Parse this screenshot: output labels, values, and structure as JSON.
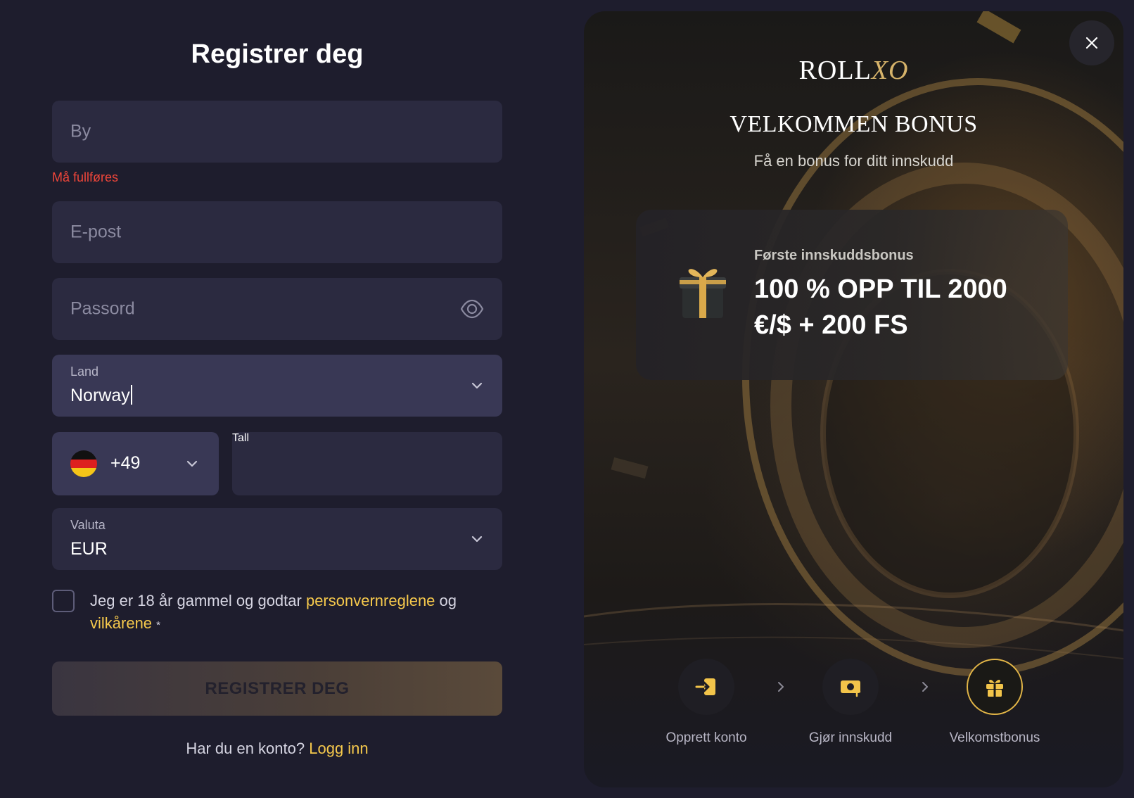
{
  "form": {
    "title": "Registrer deg",
    "city": {
      "placeholder": "By",
      "error": "Må fullføres"
    },
    "email": {
      "placeholder": "E-post"
    },
    "password": {
      "placeholder": "Passord"
    },
    "country": {
      "label": "Land",
      "value": "Norway"
    },
    "phone": {
      "code": "+49",
      "placeholder": "Tall"
    },
    "currency": {
      "label": "Valuta",
      "value": "EUR"
    },
    "consent": {
      "text_before": "Jeg er 18 år gammel og godtar ",
      "privacy_link": "personvernreglene",
      "text_middle": " og ",
      "terms_link": "vilkårene",
      "required_mark": "*"
    },
    "submit_label": "REGISTRER DEG",
    "login_prompt": "Har du en konto? ",
    "login_link": "Logg inn"
  },
  "promo": {
    "logo_main": "ROLL",
    "logo_accent": "XO",
    "headline": "VELKOMMEN BONUS",
    "subtitle": "Få en bonus for ditt innskudd",
    "card": {
      "kicker": "Første innskuddsbonus",
      "amount_line1": "100 % OPP TIL 2000",
      "amount_line2": "€/$ + 200 FS"
    },
    "steps": [
      {
        "label": "Opprett konto",
        "icon": "login-icon"
      },
      {
        "label": "Gjør innskudd",
        "icon": "deposit-icon"
      },
      {
        "label": "Velkomstbonus",
        "icon": "gift-icon"
      }
    ]
  },
  "colors": {
    "background": "#1e1d2d",
    "input": "#2b2a40",
    "input_active": "#393855",
    "accent_gold": "#f6c94c",
    "error": "#f0463a"
  }
}
